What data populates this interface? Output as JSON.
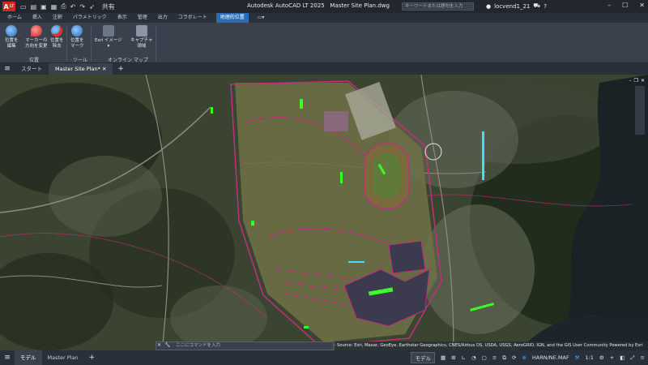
{
  "titlebar": {
    "logo": "A",
    "logo_sub": "LT",
    "share": "共有",
    "app_title": "Autodesk AutoCAD LT 2025",
    "file_title": "Master Site Plan.dwg",
    "search_placeholder": "キーワードまたは語句を入力",
    "user": "locvend1_21"
  },
  "ribbon_tabs": [
    "ホーム",
    "挿入",
    "注釈",
    "パラメトリック",
    "表示",
    "管理",
    "出力",
    "コラボレート",
    "地理的位置"
  ],
  "active_tab": "地理的位置",
  "ribbon": {
    "buttons": [
      {
        "label1": "位置を",
        "label2": "編集",
        "icon": "globe-edit-icon",
        "color": "#4a9ae0"
      },
      {
        "label1": "マーカーの",
        "label2": "方向を変更",
        "icon": "marker-pin-icon",
        "color": "#e04a4a"
      },
      {
        "label1": "位置を",
        "label2": "除去",
        "icon": "globe-remove-icon",
        "color": "#4a9ae0"
      },
      {
        "label1": "位置を",
        "label2": "マーク",
        "icon": "globe-mark-icon",
        "color": "#4a9ae0"
      },
      {
        "label1": "Esri イメージ",
        "label2": "",
        "icon": "esri-image-icon",
        "color": "#8c95a2"
      },
      {
        "label1": "キャプチャ",
        "label2": "領域",
        "icon": "capture-area-icon",
        "color": "#8c95a2"
      }
    ],
    "groups": [
      "位置",
      "ツール",
      "オンライン マップ"
    ]
  },
  "file_tabs": {
    "start": "スタート",
    "active": "Master Site Plan*"
  },
  "map": {
    "command_placeholder": "ここにコマンドを入力",
    "attribution": "Source: Esri, Maxar, GeoEye, Earthstar Geographics, CNES/Airbus DS, USDA, USGS, AeroGRID, IGN, and the GIS User Community Powered by Esri"
  },
  "status": {
    "model_tab": "モデル",
    "layout_tab": "Master Plan",
    "model_btn": "モデル",
    "coord_system": "HARN/NE.MAF",
    "scale": "1:1"
  },
  "colors": {
    "accent": "#2b6cb8",
    "site_lines": "#c0307a",
    "green_marks": "#3cff2a",
    "cyan_marks": "#3ae2ff"
  }
}
